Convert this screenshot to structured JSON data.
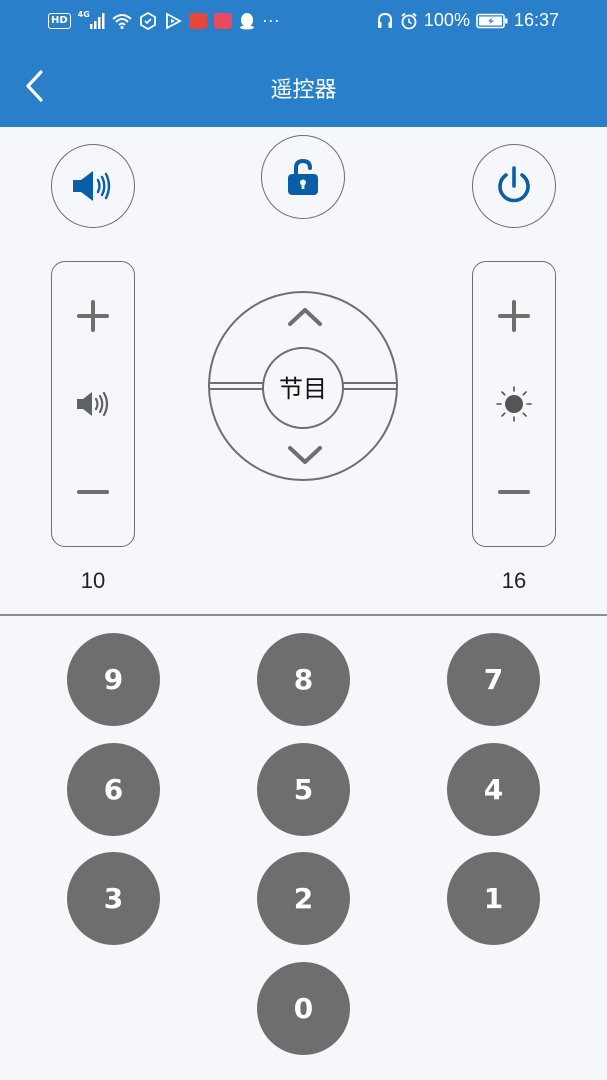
{
  "status_bar": {
    "left_badge": "HD",
    "network": "4G",
    "more": "···",
    "battery": "100%",
    "time": "16:37"
  },
  "header": {
    "title": "遥控器",
    "bg_color": "#2a7fcb"
  },
  "controls": {
    "top_buttons": [
      {
        "name": "sound",
        "icon": "speaker-icon"
      },
      {
        "name": "lock",
        "icon": "unlock-icon"
      },
      {
        "name": "power",
        "icon": "power-icon"
      }
    ],
    "volume": {
      "icon": "speaker-small-icon",
      "level": "10"
    },
    "brightness": {
      "icon": "sun-icon",
      "level": "16"
    },
    "dpad_center": "节目"
  },
  "keypad": {
    "keys": [
      "9",
      "8",
      "7",
      "6",
      "5",
      "4",
      "3",
      "2",
      "1",
      "0"
    ]
  },
  "colors": {
    "accent": "#2a7fcb",
    "icon_blue": "#0a5ea8",
    "key_gray": "#6e6e6e",
    "outline": "#6b6f6f"
  }
}
